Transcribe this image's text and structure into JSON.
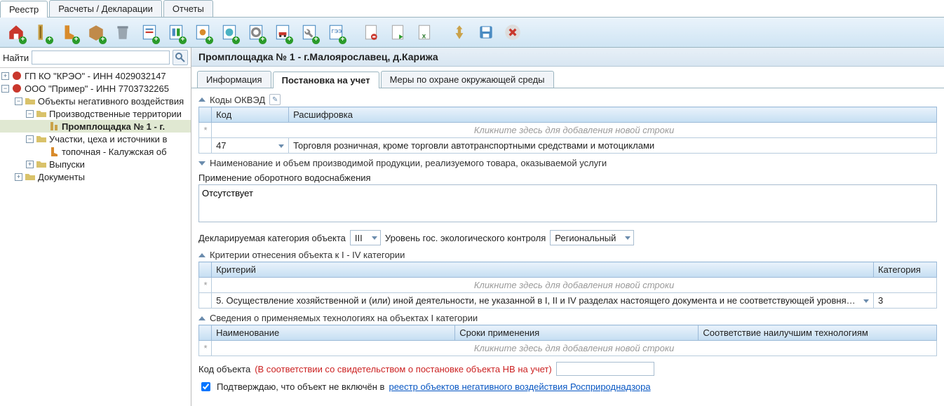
{
  "main_tabs": [
    "Реестр",
    "Расчеты / Декларации",
    "Отчеты"
  ],
  "active_main_tab": 0,
  "search": {
    "label": "Найти",
    "value": ""
  },
  "tree": {
    "n0": "ГП КО \"КРЭО\" - ИНН 4029032147",
    "n1": "ООО \"Пример\" - ИНН 7703732265",
    "n2": "Объекты негативного воздействия",
    "n3": "Производственные территории",
    "n4": "Промплощадка № 1 - г.",
    "n5": "Участки, цеха и источники в",
    "n6": "топочная - Калужская об",
    "n7": "Выпуски",
    "n8": "Документы"
  },
  "content_title": "Промплощадка № 1 - г.Малоярославец, д.Карижа",
  "inner_tabs": [
    "Информация",
    "Постановка на учет",
    "Меры по охране окружающей среды"
  ],
  "active_inner_tab": 1,
  "okved": {
    "section": "Коды ОКВЭД",
    "col_code": "Код",
    "col_desc": "Расшифровка",
    "hint": "Кликните здесь для добавления новой строки",
    "row_code": "47",
    "row_desc": "Торговля розничная, кроме торговли автотранспортными средствами и мотоциклами"
  },
  "prod_section": "Наименование и объем производимой продукции, реализуемого товара, оказываемой услуги",
  "water_label": "Применение оборотного водоснабжения",
  "water_value": "Отсутствует",
  "category": {
    "label": "Декларируемая категория объекта",
    "value": "III",
    "control_label": "Уровень гос. экологического контроля",
    "control_value": "Региональный"
  },
  "criteria": {
    "section": "Критерии отнесения объекта к I - IV категории",
    "col_crit": "Критерий",
    "col_cat": "Категория",
    "hint": "Кликните здесь для добавления новой строки",
    "row_crit": "5. Осуществление хозяйственной и (или) иной деятельности, не указанной в I, II и IV разделах настоящего документа и не соответствующей уровня…",
    "row_cat": "3"
  },
  "tech": {
    "section": "Сведения о применяемых технологиях на объектах I категории",
    "col_name": "Наименование",
    "col_term": "Сроки применения",
    "col_best": "Соответствие наилучшим технологиям",
    "hint": "Кликните здесь для добавления новой строки"
  },
  "code": {
    "label": "Код объекта",
    "note": "(В соответствии со свидетельством о постановке объекта НВ на учет)",
    "value": ""
  },
  "confirm": {
    "checked": true,
    "text_before": "Подтверждаю, что объект не включён в ",
    "link": "реестр объектов негативного воздействия Росприроднадзора"
  }
}
